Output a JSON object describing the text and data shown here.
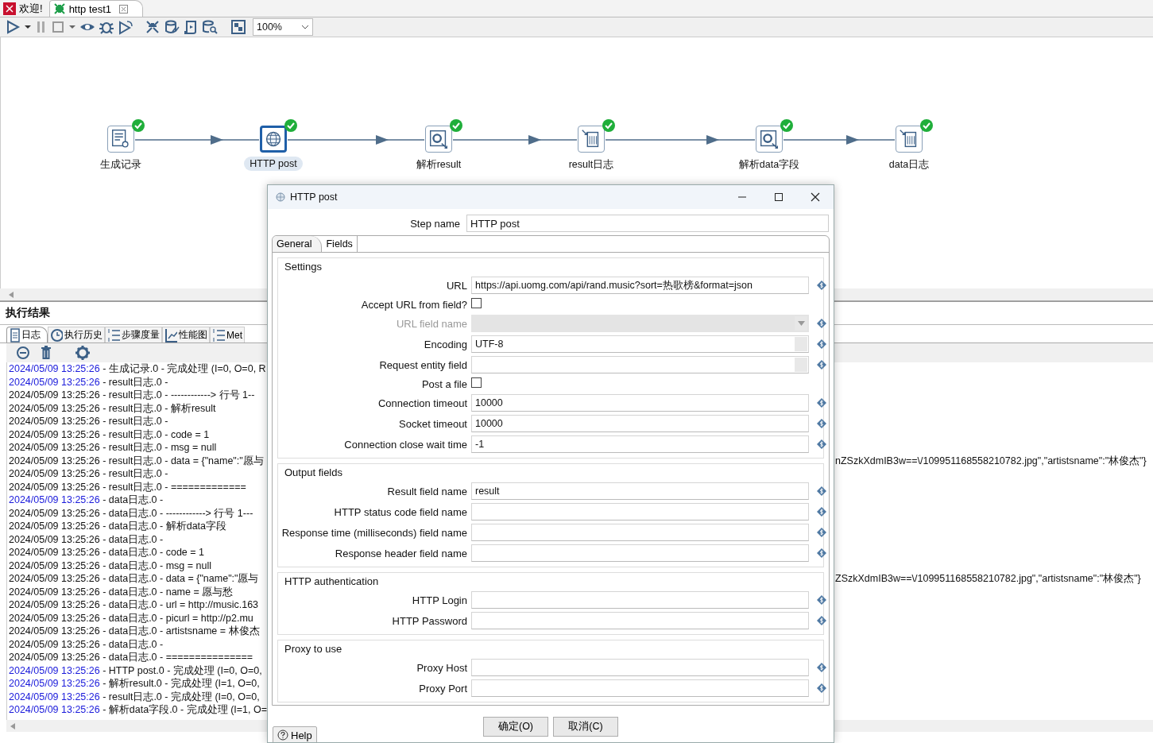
{
  "editor_tabs": [
    {
      "label": "欢迎!",
      "kind": "welcome",
      "selected": false
    },
    {
      "label": "http test1",
      "kind": "transformation",
      "selected": true
    }
  ],
  "toolbar": {
    "zoom": "100%"
  },
  "canvas": {
    "steps": [
      {
        "label": "生成记录",
        "kind": "generator",
        "selected": false,
        "ok": true
      },
      {
        "label": "HTTP post",
        "kind": "http",
        "selected": true,
        "ok": true
      },
      {
        "label": "解析result",
        "kind": "parse",
        "selected": false,
        "ok": true
      },
      {
        "label": "result日志",
        "kind": "log",
        "selected": false,
        "ok": true
      },
      {
        "label": "解析data字段",
        "kind": "parse",
        "selected": false,
        "ok": true
      },
      {
        "label": "data日志",
        "kind": "log",
        "selected": false,
        "ok": true
      }
    ]
  },
  "results": {
    "title": "执行结果",
    "tabs": [
      {
        "label": "日志",
        "kind": "log",
        "selected": true
      },
      {
        "label": "执行历史",
        "kind": "history",
        "selected": false
      },
      {
        "label": "步骤度量",
        "kind": "metrics",
        "selected": false
      },
      {
        "label": "性能图",
        "kind": "chart",
        "selected": false
      },
      {
        "label": "Met",
        "kind": "metrics",
        "selected": false
      }
    ],
    "log": [
      {
        "time": "2024/05/09 13:25:26",
        "message": " - 生成记录.0 - 完成处理 (I=0, O=0, R",
        "highlighted": true
      },
      {
        "time": "2024/05/09 13:25:26",
        "message": " - result日志.0 -",
        "highlighted": true
      },
      {
        "time": "2024/05/09 13:25:26",
        "message": " - result日志.0 - ------------> 行号 1--",
        "highlighted": false
      },
      {
        "time": "2024/05/09 13:25:26",
        "message": " - result日志.0 - 解析result",
        "highlighted": false
      },
      {
        "time": "2024/05/09 13:25:26",
        "message": " - result日志.0 -",
        "highlighted": false
      },
      {
        "time": "2024/05/09 13:25:26",
        "message": " - result日志.0 - code = 1",
        "highlighted": false
      },
      {
        "time": "2024/05/09 13:25:26",
        "message": " - result日志.0 - msg = null",
        "highlighted": false
      },
      {
        "time": "2024/05/09 13:25:26",
        "message": " - result日志.0 - data = {\"name\":\"愿与",
        "tail": "nZSzkXdmIB3w==\\/109951168558210782.jpg\",\"artistsname\":\"林俊杰\"}",
        "highlighted": false
      },
      {
        "time": "2024/05/09 13:25:26",
        "message": " - result日志.0 -",
        "highlighted": false
      },
      {
        "time": "2024/05/09 13:25:26",
        "message": " - result日志.0 - =============",
        "highlighted": false
      },
      {
        "time": "2024/05/09 13:25:26",
        "message": " - data日志.0 -",
        "highlighted": true
      },
      {
        "time": "2024/05/09 13:25:26",
        "message": " - data日志.0 - ------------> 行号 1---",
        "highlighted": false
      },
      {
        "time": "2024/05/09 13:25:26",
        "message": " - data日志.0 - 解析data字段",
        "highlighted": false
      },
      {
        "time": "2024/05/09 13:25:26",
        "message": " - data日志.0 -",
        "highlighted": false
      },
      {
        "time": "2024/05/09 13:25:26",
        "message": " - data日志.0 - code = 1",
        "highlighted": false
      },
      {
        "time": "2024/05/09 13:25:26",
        "message": " - data日志.0 - msg = null",
        "highlighted": false
      },
      {
        "time": "2024/05/09 13:25:26",
        "message": " - data日志.0 - data = {\"name\":\"愿与",
        "tail": "ZSzkXdmIB3w==\\/109951168558210782.jpg\",\"artistsname\":\"林俊杰\"}",
        "highlighted": false
      },
      {
        "time": "2024/05/09 13:25:26",
        "message": " - data日志.0 - name = 愿与愁",
        "highlighted": false
      },
      {
        "time": "2024/05/09 13:25:26",
        "message": " - data日志.0 - url = http://music.163",
        "highlighted": false
      },
      {
        "time": "2024/05/09 13:25:26",
        "message": " - data日志.0 - picurl = http://p2.mu",
        "highlighted": false
      },
      {
        "time": "2024/05/09 13:25:26",
        "message": " - data日志.0 - artistsname = 林俊杰",
        "highlighted": false
      },
      {
        "time": "2024/05/09 13:25:26",
        "message": " - data日志.0 -",
        "highlighted": false
      },
      {
        "time": "2024/05/09 13:25:26",
        "message": " - data日志.0 - ===============",
        "highlighted": false
      },
      {
        "time": "2024/05/09 13:25:26",
        "message": " - HTTP post.0 - 完成处理 (I=0, O=0,",
        "highlighted": true
      },
      {
        "time": "2024/05/09 13:25:26",
        "message": " - 解析result.0 - 完成处理 (I=1, O=0,",
        "highlighted": true
      },
      {
        "time": "2024/05/09 13:25:26",
        "message": " - result日志.0 - 完成处理 (I=0, O=0,",
        "highlighted": true
      },
      {
        "time": "2024/05/09 13:25:26",
        "message": " - 解析data字段.0 - 完成处理 (I=1, O=",
        "highlighted": true
      }
    ]
  },
  "dialog": {
    "title": "HTTP post",
    "step_name_label": "Step name",
    "step_name": "HTTP post",
    "tabs": [
      {
        "label": "General",
        "selected": true
      },
      {
        "label": "Fields",
        "selected": false
      }
    ],
    "groups": [
      {
        "title": "Settings",
        "rows": [
          {
            "label": "URL",
            "kind": "text",
            "value": "https://api.uomg.com/api/rand.music?sort=热歌榜&format=json",
            "disabled": false
          },
          {
            "label": "Accept URL from field?",
            "kind": "checkbox",
            "checked": false
          },
          {
            "label": "URL field name",
            "kind": "combo",
            "disabled": true
          },
          {
            "label": "Encoding",
            "kind": "combo",
            "value": "UTF-8",
            "disabled": false
          },
          {
            "label": "Request entity field",
            "kind": "combo",
            "disabled": false
          },
          {
            "label": "Post a file",
            "kind": "checkbox",
            "checked": false
          },
          {
            "label": "Connection timeout",
            "kind": "text",
            "value": "10000",
            "disabled": false
          },
          {
            "label": "Socket timeout",
            "kind": "text",
            "value": "10000",
            "disabled": false
          },
          {
            "label": "Connection close wait time",
            "kind": "text",
            "value": "-1",
            "disabled": false
          }
        ]
      },
      {
        "title": "Output fields",
        "rows": [
          {
            "label": "Result field name",
            "kind": "text",
            "value": "result",
            "disabled": false
          },
          {
            "label": "HTTP status code field name",
            "kind": "text",
            "disabled": false
          },
          {
            "label": "Response time (milliseconds) field name",
            "kind": "text",
            "disabled": false
          },
          {
            "label": "Response header field name",
            "kind": "text",
            "disabled": false
          }
        ]
      },
      {
        "title": "HTTP authentication",
        "rows": [
          {
            "label": "HTTP Login",
            "kind": "text",
            "disabled": false
          },
          {
            "label": "HTTP Password",
            "kind": "text",
            "disabled": false
          }
        ]
      },
      {
        "title": "Proxy to use",
        "rows": [
          {
            "label": "Proxy Host",
            "kind": "text",
            "disabled": false
          },
          {
            "label": "Proxy Port",
            "kind": "text",
            "disabled": false
          }
        ]
      }
    ],
    "buttons": [
      "确定(O)",
      "取消(C)"
    ],
    "help": "Help"
  }
}
